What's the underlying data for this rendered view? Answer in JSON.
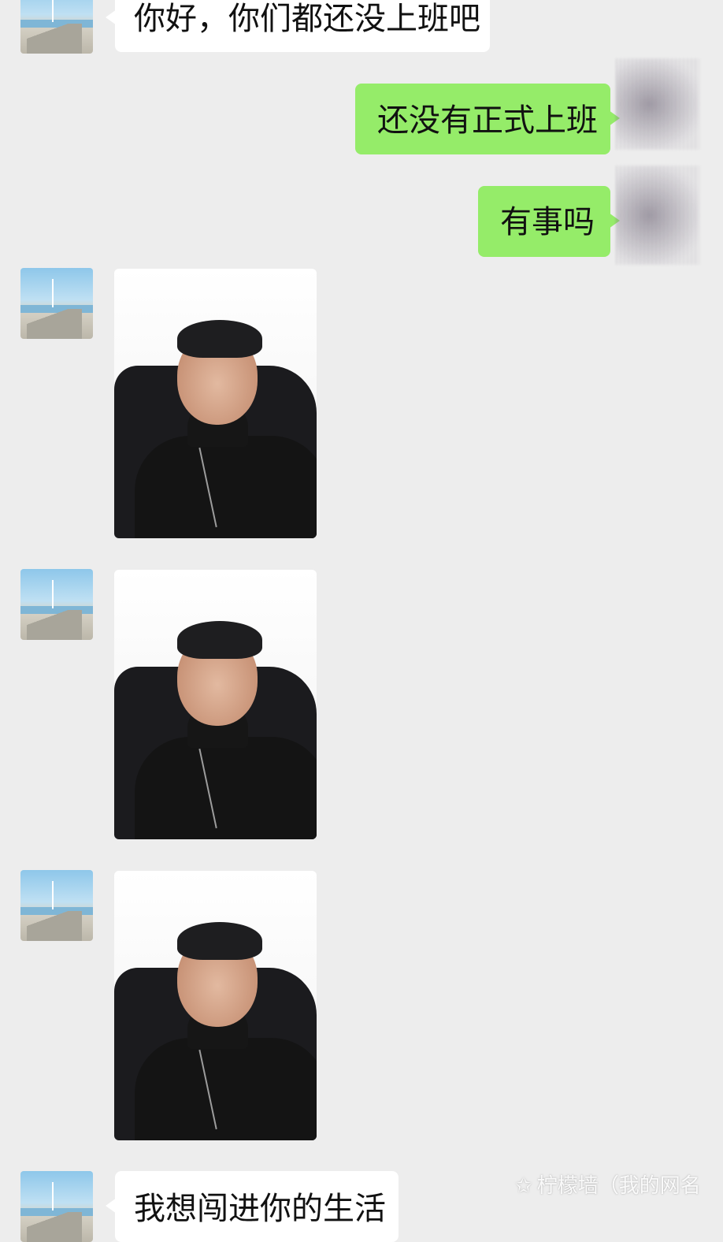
{
  "messages": [
    {
      "sender": "contact",
      "type": "text",
      "text": "你好，你们都还没上班吧"
    },
    {
      "sender": "me",
      "type": "text",
      "text": "还没有正式上班"
    },
    {
      "sender": "me",
      "type": "text",
      "text": "有事吗"
    },
    {
      "sender": "contact",
      "type": "image",
      "description": "selfie photo"
    },
    {
      "sender": "contact",
      "type": "image",
      "description": "selfie photo"
    },
    {
      "sender": "contact",
      "type": "image",
      "description": "selfie photo"
    },
    {
      "sender": "contact",
      "type": "text",
      "text": "我想闯进你的生活"
    }
  ],
  "watermark": {
    "icon": "star-icon",
    "text": "柠檬墙（我的网名"
  },
  "colors": {
    "background": "#ededed",
    "incoming_bubble": "#ffffff",
    "outgoing_bubble": "#95ec69"
  }
}
